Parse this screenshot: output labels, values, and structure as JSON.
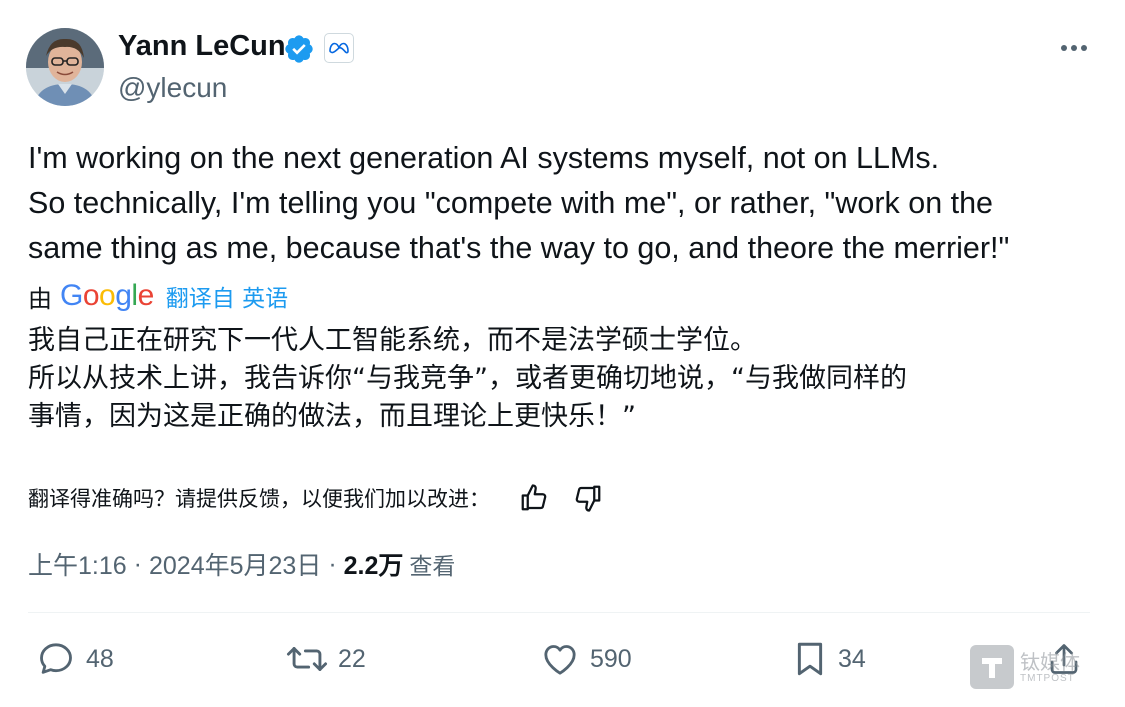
{
  "author": {
    "name": "Yann LeCun",
    "handle": "@ylecun",
    "affiliation_icon": "meta-logo-icon",
    "verified_color": "#1d9bf0"
  },
  "tweet": {
    "lines": [
      "I'm working on the next generation AI systems myself, not on LLMs.",
      "So technically, I'm telling you \"compete with me\", or rather, \"work on the",
      "same thing as me, because that's the way to go, and theore the merrier!\""
    ]
  },
  "translation": {
    "prefix": "由",
    "provider": "Google",
    "source_link": "翻译自 英语",
    "lines": [
      "我自己正在研究下一代人工智能系统，而不是法学硕士学位。",
      "所以从技术上讲，我告诉你“与我竞争”，或者更确切地说，“与我做同样的",
      "事情，因为这是正确的做法，而且理论上更快乐！”"
    ],
    "feedback_prompt": "翻译得准确吗？请提供反馈，以便我们加以改进："
  },
  "meta": {
    "time": "上午1:16",
    "separator": "·",
    "date": "2024年5月23日",
    "views_count": "2.2万",
    "views_label": "查看"
  },
  "actions": {
    "replies": "48",
    "retweets": "22",
    "likes": "590",
    "bookmarks": "34"
  },
  "watermark": {
    "text_cn": "钛媒体",
    "text_en": "TMTPOST"
  },
  "colors": {
    "accent": "#1d9bf0",
    "secondary_text": "#536471",
    "primary_text": "#0f1419"
  }
}
